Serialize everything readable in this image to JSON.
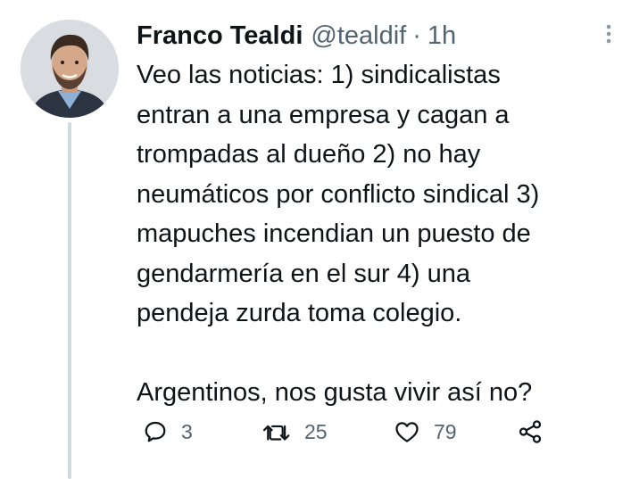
{
  "tweet": {
    "display_name": "Franco Tealdi",
    "handle": "@tealdif",
    "separator": "·",
    "timestamp": "1h",
    "text": "Veo las noticias: 1) sindicalistas\nentran a una empresa y cagan a\ntrompadas al dueño 2) no hay\nneumáticos por conflicto sindical 3)\nmapuches incendian un puesto de\ngendarmería en el sur 4) una\npendeja zurda toma colegio.\n\nArgentinos, nos gusta vivir así no?",
    "actions": {
      "replies": "3",
      "retweets": "25",
      "likes": "79"
    }
  },
  "icons": {
    "reply": "reply-icon",
    "retweet": "retweet-icon",
    "like": "heart-icon",
    "share": "share-icon",
    "more": "more-vertical-icon"
  },
  "colors": {
    "text_primary": "#0f1419",
    "text_secondary": "#536471",
    "thread_line": "#cfd9de"
  }
}
